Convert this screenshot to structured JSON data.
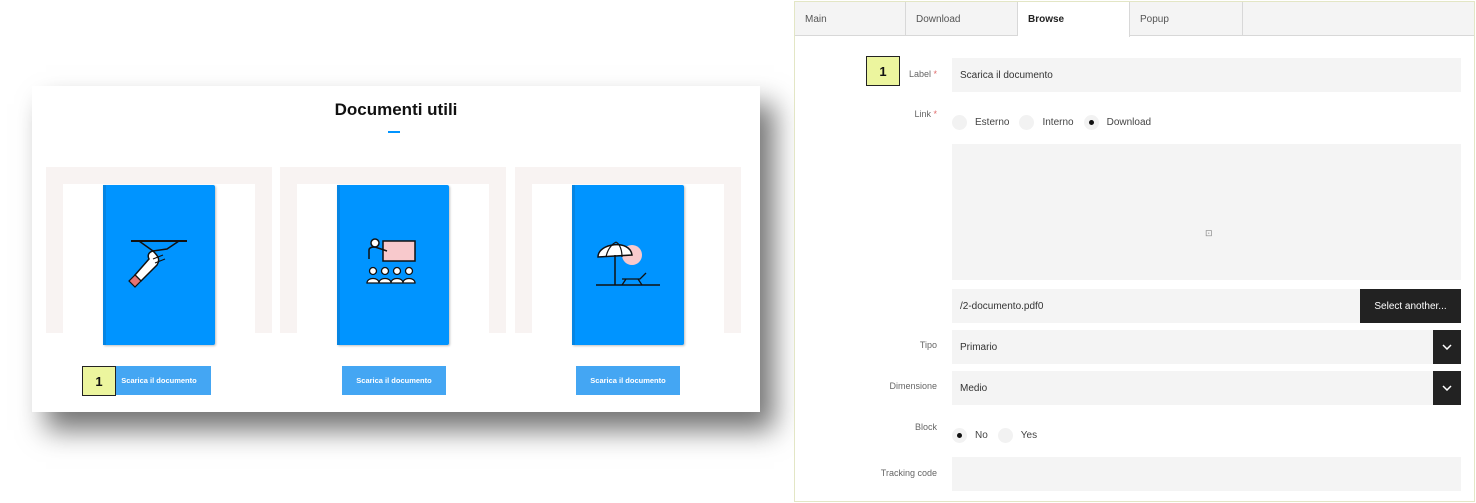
{
  "preview": {
    "title": "Documenti utili",
    "button_label": "Scarica il documento",
    "marker": "1"
  },
  "editor": {
    "tabs": [
      "Main",
      "Download",
      "Browse",
      "Popup"
    ],
    "active_tab": "Browse",
    "marker": "1",
    "label_field": {
      "label": "Label",
      "required": "*",
      "value": "Scarica il documento"
    },
    "link": {
      "label": "Link",
      "required": "*",
      "options": [
        "Esterno",
        "Interno",
        "Download"
      ],
      "selected": "Download"
    },
    "file": {
      "name": "/2-documento.pdf0",
      "select_label": "Select another..."
    },
    "tipo": {
      "label": "Tipo",
      "value": "Primario"
    },
    "dimensione": {
      "label": "Dimensione",
      "value": "Medio"
    },
    "block": {
      "label": "Block",
      "options": [
        "No",
        "Yes"
      ],
      "selected": "No"
    },
    "tracking": {
      "label": "Tracking code",
      "value": ""
    }
  },
  "colors": {
    "accent": "#0094ff",
    "button": "#44a6f3",
    "marker": "#ecf59e",
    "dark": "#222222"
  },
  "icons": [
    "waiter-tray-icon",
    "presentation-board-icon",
    "beach-umbrella-icon",
    "chevron-down-icon",
    "cursor-icon"
  ]
}
